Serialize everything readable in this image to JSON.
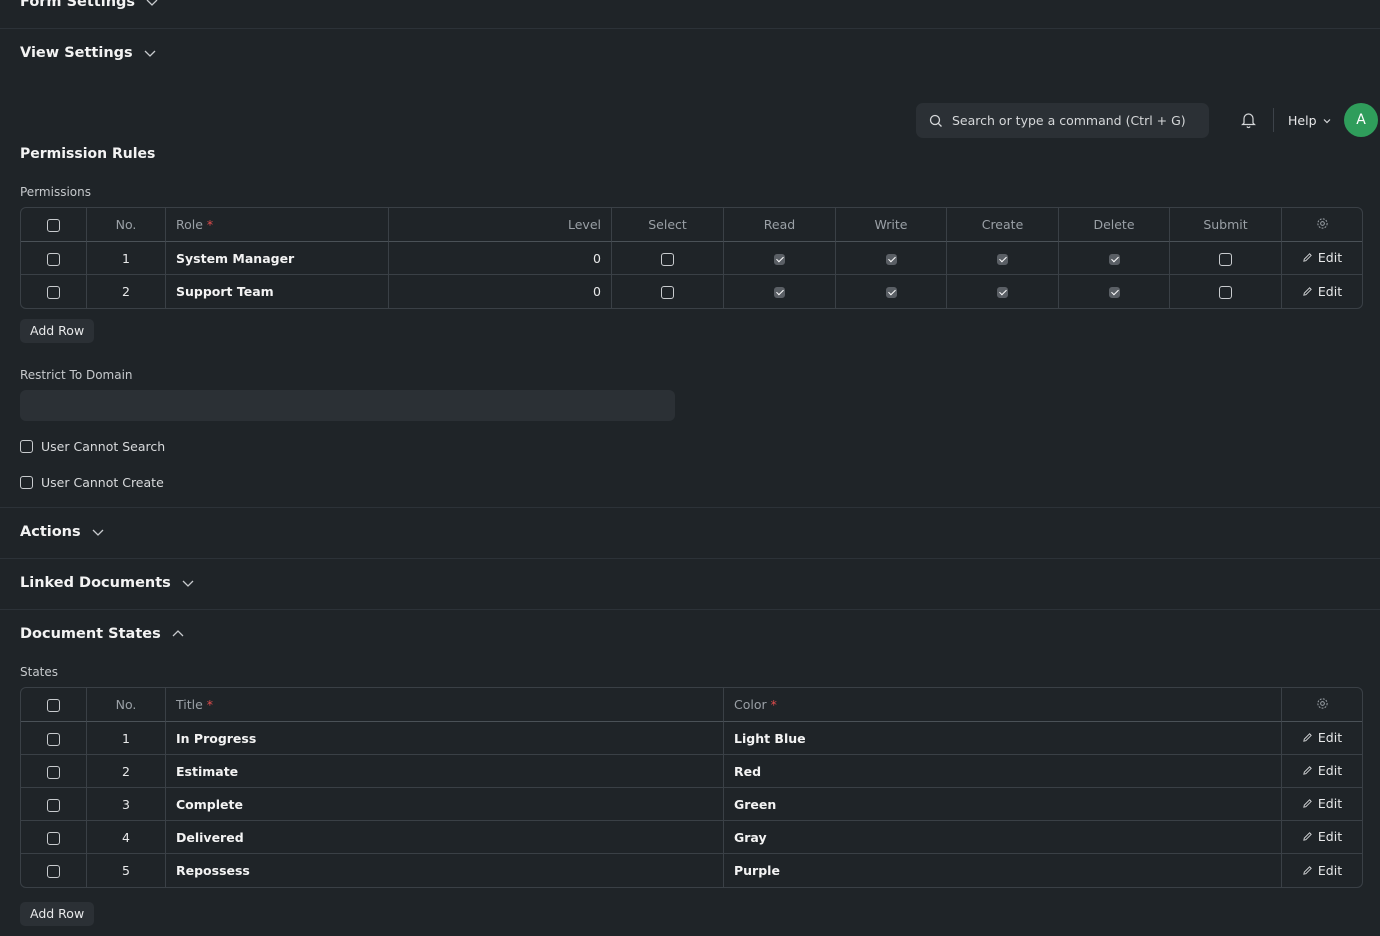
{
  "sections": {
    "form_settings": "Form Settings",
    "view_settings": "View Settings",
    "permission_rules": "Permission Rules",
    "actions": "Actions",
    "linked_documents": "Linked Documents",
    "document_states": "Document States"
  },
  "navbar": {
    "search_placeholder": "Search or type a command (Ctrl + G)",
    "help_label": "Help",
    "avatar_initial": "A"
  },
  "permissions": {
    "label": "Permissions",
    "columns": {
      "no": "No.",
      "role": "Role",
      "level": "Level",
      "select": "Select",
      "read": "Read",
      "write": "Write",
      "create": "Create",
      "delete": "Delete",
      "submit": "Submit"
    },
    "rows": [
      {
        "no": "1",
        "role": "System Manager",
        "level": "0",
        "select": false,
        "read": true,
        "write": true,
        "create": true,
        "delete": true,
        "submit": false
      },
      {
        "no": "2",
        "role": "Support Team",
        "level": "0",
        "select": false,
        "read": true,
        "write": true,
        "create": true,
        "delete": true,
        "submit": false
      }
    ],
    "edit_label": "Edit",
    "add_row": "Add Row"
  },
  "restrict_to_domain": {
    "label": "Restrict To Domain",
    "value": ""
  },
  "checkboxes": {
    "user_cannot_search": "User Cannot Search",
    "user_cannot_create": "User Cannot Create"
  },
  "states": {
    "label": "States",
    "columns": {
      "no": "No.",
      "title": "Title",
      "color": "Color"
    },
    "rows": [
      {
        "no": "1",
        "title": "In Progress",
        "color": "Light Blue"
      },
      {
        "no": "2",
        "title": "Estimate",
        "color": "Red"
      },
      {
        "no": "3",
        "title": "Complete",
        "color": "Green"
      },
      {
        "no": "4",
        "title": "Delivered",
        "color": "Gray"
      },
      {
        "no": "5",
        "title": "Repossess",
        "color": "Purple"
      }
    ],
    "edit_label": "Edit",
    "add_row": "Add Row"
  },
  "required_mark": "*",
  "colors": {
    "background": "#1f2428",
    "avatar": "#2f9d5b",
    "required": "#e24c4c"
  }
}
